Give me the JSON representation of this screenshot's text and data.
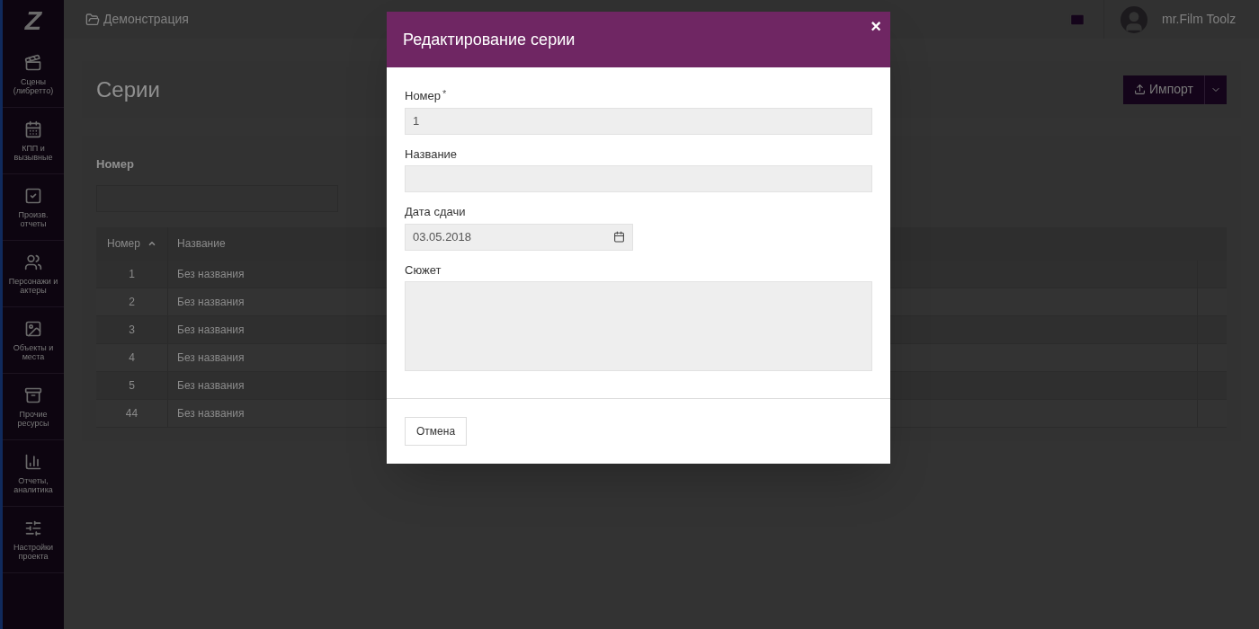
{
  "sidebar": {
    "logo": "Z",
    "items": [
      {
        "label": "Сцены (либретто)"
      },
      {
        "label": "КПП и вызывные"
      },
      {
        "label": "Произв. отчеты"
      },
      {
        "label": "Персонажи и актеры"
      },
      {
        "label": "Объекты и места"
      },
      {
        "label": "Прочие ресурсы"
      },
      {
        "label": "Отчеты, аналитика"
      },
      {
        "label": "Настройки проекта"
      }
    ]
  },
  "topbar": {
    "breadcrumb": "Демонстрация",
    "user": "mr.Film Toolz"
  },
  "page": {
    "title": "Серии",
    "import_button": "Импорт"
  },
  "filter": {
    "label": "Номер"
  },
  "table": {
    "columns": [
      {
        "label": "Номер",
        "sorted": true
      },
      {
        "label": "Название",
        "sorted": false
      }
    ],
    "rows": [
      {
        "number": "1",
        "name": "Без названия"
      },
      {
        "number": "2",
        "name": "Без названия"
      },
      {
        "number": "3",
        "name": "Без названия"
      },
      {
        "number": "4",
        "name": "Без названия"
      },
      {
        "number": "5",
        "name": "Без названия"
      },
      {
        "number": "44",
        "name": "Без названия"
      }
    ]
  },
  "modal": {
    "title": "Редактирование серии",
    "close": "×",
    "fields": [
      {
        "kind": "text",
        "label": "Номер",
        "required_mark": "*",
        "value": "1"
      },
      {
        "kind": "text",
        "label": "Название"
      },
      {
        "kind": "date",
        "label": "Дата сдачи",
        "value": "03.05.2018"
      },
      {
        "kind": "textarea",
        "label": "Сюжет"
      }
    ],
    "cancel": "Отмена"
  }
}
